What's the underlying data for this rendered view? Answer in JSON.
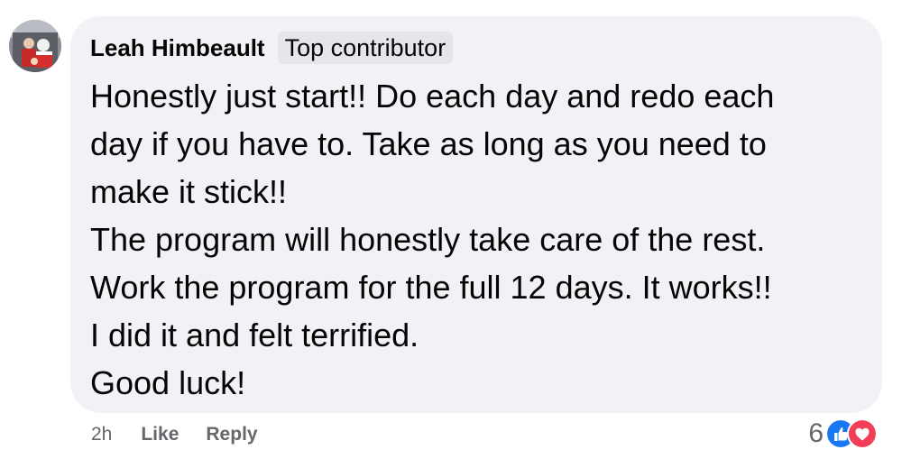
{
  "comment": {
    "author": "Leah Himbeault",
    "badge": "Top contributor",
    "lines": [
      "Honestly just start!! Do each day and redo each",
      "day if you have to. Take as long as you need to",
      "make it stick!!",
      "The program will honestly take care of the rest.",
      "Work the program for the full 12 days. It works!!",
      "I did it and felt terrified.",
      "Good luck!"
    ]
  },
  "actions": {
    "timestamp": "2h",
    "like_label": "Like",
    "reply_label": "Reply"
  },
  "reactions": {
    "count": "6",
    "types": [
      "like-icon",
      "love-icon"
    ],
    "like_color": "#1877f2",
    "love_color": "#f33e58"
  },
  "colors": {
    "bubble_bg": "#f0f2f5",
    "meta_text": "#65676b",
    "badge_bg": "#e4e6eb"
  }
}
